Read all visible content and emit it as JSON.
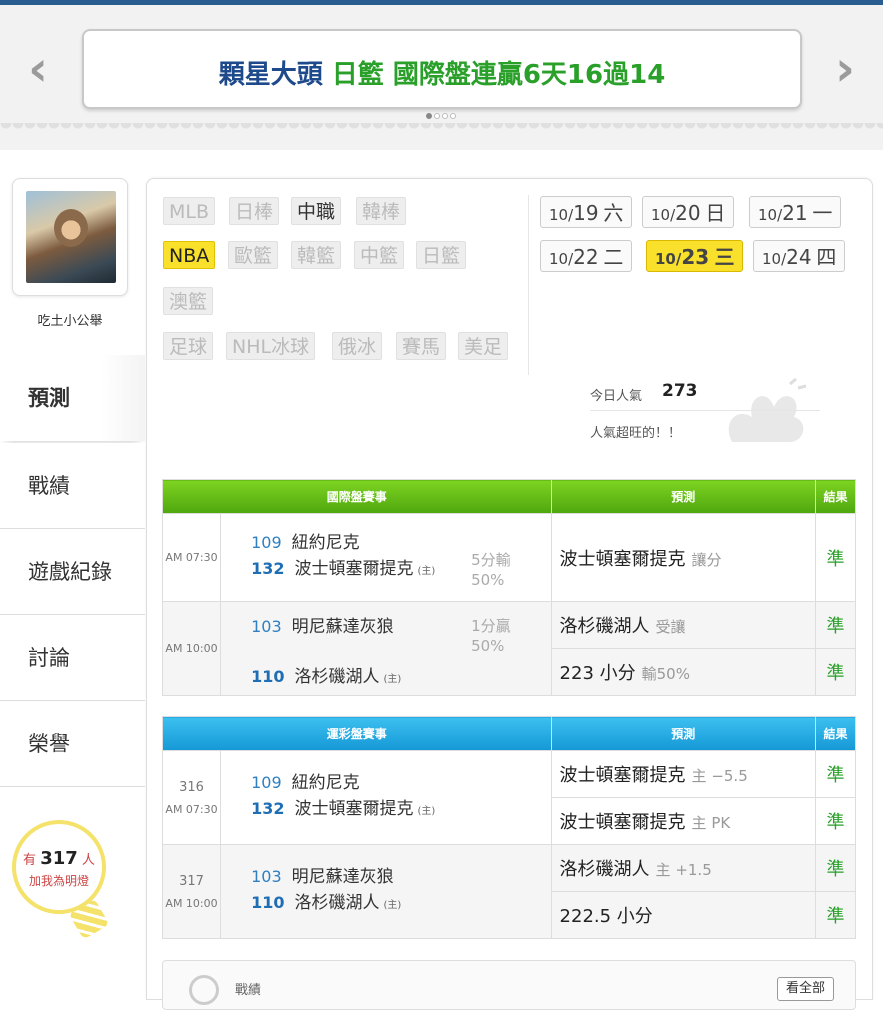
{
  "banner": {
    "headline_part1": "顆星大頭",
    "headline_part2": "日籃 國際盤連贏6天16過14",
    "prev_icon": "chevron-left-icon",
    "next_icon": "chevron-right-icon",
    "slide_count": 4,
    "active_slide": 1
  },
  "profile": {
    "username": "吃土小公舉"
  },
  "nav": {
    "predict": "預測",
    "record": "戰績",
    "game_log": "遊戲紀錄",
    "discussion": "討論",
    "honor": "榮譽"
  },
  "followers": {
    "prefix": "有",
    "count": "317",
    "suffix": "人",
    "line2": "加我為明燈"
  },
  "sports": {
    "mlb": "MLB",
    "npb": "日棒",
    "cpbl": "中職",
    "kbo": "韓棒",
    "nba": "NBA",
    "euro": "歐籃",
    "kbl": "韓籃",
    "sbl": "中籃",
    "bjl": "日籃",
    "nbl": "澳籃",
    "soccer": "足球",
    "nhl": "NHL冰球",
    "khl": "俄冰",
    "horse": "賽馬",
    "nfl": "美足"
  },
  "dates": [
    {
      "md": "10/",
      "d": "19",
      "w": "六"
    },
    {
      "md": "10/",
      "d": "20",
      "w": "日"
    },
    {
      "md": "10/",
      "d": "21",
      "w": "一"
    },
    {
      "md": "10/",
      "d": "22",
      "w": "二"
    },
    {
      "md": "10/",
      "d": "23",
      "w": "三"
    },
    {
      "md": "10/",
      "d": "24",
      "w": "四"
    }
  ],
  "popularity": {
    "label": "今日人氣",
    "value": "273",
    "message": "人氣超旺的！！"
  },
  "intl_table": {
    "col1": "國際盤賽事",
    "col2": "預測",
    "col3": "結果",
    "rows": [
      {
        "time": "AM 07:30",
        "away_no": "109",
        "away": "紐約尼克",
        "home_no": "132",
        "home": "波士頓塞爾提克",
        "home_tag": "(主)",
        "odds1": "5分輸",
        "odds2": "50%",
        "preds": [
          {
            "team": "波士頓塞爾提克",
            "note": "讓分",
            "result": "準"
          }
        ]
      },
      {
        "time": "AM 10:00",
        "away_no": "103",
        "away": "明尼蘇達灰狼",
        "home_no": "110",
        "home": "洛杉磯湖人",
        "home_tag": "(主)",
        "odds1": "1分贏",
        "odds2": "50%",
        "preds": [
          {
            "team": "洛杉磯湖人",
            "note": "受讓",
            "result": "準"
          },
          {
            "team": "223 小分",
            "note": "輸50%",
            "result": "準"
          }
        ]
      }
    ]
  },
  "lottery_table": {
    "col1": "運彩盤賽事",
    "col2": "預測",
    "col3": "結果",
    "rows": [
      {
        "game_no": "316",
        "time": "AM 07:30",
        "away_no": "109",
        "away": "紐約尼克",
        "home_no": "132",
        "home": "波士頓塞爾提克",
        "home_tag": "(主)",
        "preds": [
          {
            "team": "波士頓塞爾提克",
            "note": "主 −5.5",
            "result": "準"
          },
          {
            "team": "波士頓塞爾提克",
            "note": "主 PK",
            "result": "準"
          }
        ]
      },
      {
        "game_no": "317",
        "time": "AM 10:00",
        "away_no": "103",
        "away": "明尼蘇達灰狼",
        "home_no": "110",
        "home": "洛杉磯湖人",
        "home_tag": "(主)",
        "preds": [
          {
            "team": "洛杉磯湖人",
            "note": "主 +1.5",
            "result": "準"
          },
          {
            "team": "222.5 小分",
            "note": "",
            "result": "準"
          }
        ]
      }
    ]
  },
  "record_box": {
    "label": "戰績",
    "view_all": "看全部"
  }
}
